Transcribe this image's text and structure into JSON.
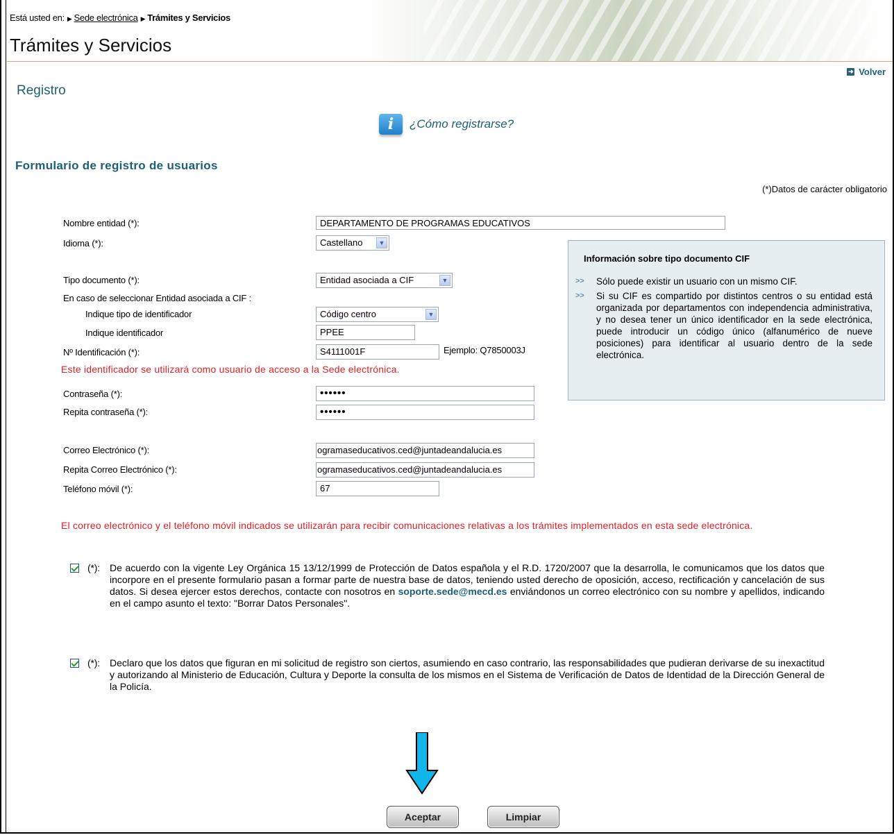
{
  "breadcrumb": {
    "prefix": "Está usted en:",
    "link": "Sede electrónica",
    "current": "Trámites y Servicios"
  },
  "header": {
    "title": "Trámites y Servicios"
  },
  "volver": "Volver",
  "section_title": "Registro",
  "howto": "¿Cómo registrarse?",
  "form_title": "Formulario de registro de usuarios",
  "required_note": "(*)Datos de carácter obligatorio",
  "fields": {
    "entity_name": {
      "label": "Nombre entidad (*):",
      "value": "DEPARTAMENTO DE PROGRAMAS EDUCATIVOS"
    },
    "language": {
      "label": "Idioma (*):",
      "value": "Castellano"
    },
    "doc_type": {
      "label": "Tipo documento (*):",
      "value": "Entidad asociada a CIF"
    },
    "cif_note": "En caso de seleccionar Entidad asociada a CIF :",
    "id_type": {
      "label": "Indique tipo de identificador",
      "value": "Código centro"
    },
    "identifier": {
      "label": "Indique identificador",
      "value": "PPEE"
    },
    "id_number": {
      "label": "Nº Identificación (*):",
      "value": "S4111001F",
      "example": "Ejemplo: Q7850003J"
    },
    "id_warning": "Este identificador se utilizará como usuario de acceso a la Sede electrónica.",
    "password": {
      "label": "Contraseña (*):",
      "value": "••••••"
    },
    "password_repeat": {
      "label": "Repita contraseña (*):",
      "value": "••••••"
    },
    "email": {
      "label": "Correo Electrónico (*):",
      "value": "ogramaseducativos.ced@juntadeandalucia.es"
    },
    "email_repeat": {
      "label": "Repita Correo Electrónico (*):",
      "value": "ogramaseducativos.ced@juntadeandalucia.es"
    },
    "mobile": {
      "label": "Teléfono móvil (*):",
      "value": "67"
    }
  },
  "contact_warning": "El correo electrónico y el teléfono móvil indicados se utilizarán para recibir comunicaciones relativas a los trámites implementados en esta sede electrónica.",
  "infobox": {
    "title": "Información sobre tipo documento CIF",
    "items": [
      "Sólo puede existir un usuario con un mismo CIF.",
      "Si su CIF es compartido por distintos centros o su entidad está organizada por departamentos con independencia administrativa, y no desea tener un único identificador en la sede electrónica, puede introducir un código único (alfanumérico de nueve posiciones) para identificar al usuario dentro de la sede electrónica."
    ]
  },
  "consents": {
    "lopd": {
      "prefix": "(*):",
      "text_before": "De acuerdo con la vigente Ley Orgánica 15 13/12/1999 de Protección de Datos española y el R.D. 1720/2007 que la desarrolla, le comunicamos que los datos que incorpore en el presente formulario pasan a formar parte de nuestra base de datos, teniendo usted derecho de oposición, acceso, rectificación y cancelación de sus datos. Si desea ejercer estos derechos, contacte con nosotros en",
      "email": "soporte.sede@mecd.es",
      "text_after": "enviándonos un correo electrónico con su nombre y apellidos, indicando en el campo asunto el texto: \"Borrar Datos Personales\".",
      "checked": true
    },
    "declaration": {
      "prefix": "(*):",
      "text": "Declaro que los datos que figuran en mi solicitud de registro son ciertos, asumiendo en caso contrario, las responsabilidades que pudieran derivarse de su inexactitud y autorizando al Ministerio de Educación, Cultura y Deporte la consulta de los mismos en el Sistema de Verificación de Datos de Identidad de la Dirección General de la Policía.",
      "checked": true
    }
  },
  "buttons": {
    "accept": "Aceptar",
    "clear": "Limpiar"
  },
  "colors": {
    "heading": "#1d6074",
    "warning": "#e31e24",
    "arrow": "#12b5ea"
  },
  "icons": {
    "info": "info-icon",
    "volver": "back-arrow-icon",
    "pointer": "down-arrow-icon"
  }
}
